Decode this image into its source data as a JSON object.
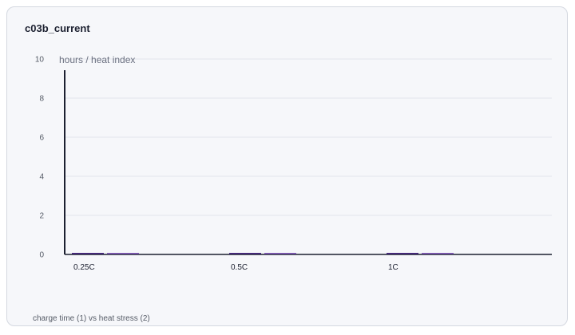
{
  "title": "c03b_current",
  "footnote": "charge time (1) vs heat stress (2)",
  "colors": {
    "background": "#f6f7fa",
    "grid": "#e3e6ec",
    "axis": "#1c2030",
    "series_1": "#4c2a86",
    "series_2": "#8a5fc0"
  },
  "chart_data": {
    "type": "bar",
    "title": "c03b_current",
    "ylabel": "hours / heat index",
    "xlabel": "",
    "categories": [
      "0.25C",
      "0.5C",
      "1C"
    ],
    "series": [
      {
        "values": [
          0,
          0,
          0
        ]
      },
      {
        "values": [
          0,
          0,
          0
        ]
      }
    ],
    "ylim": [
      0,
      10
    ],
    "yticks": [
      0,
      2,
      4,
      6,
      8,
      10
    ],
    "grid": true,
    "legend": "none"
  }
}
